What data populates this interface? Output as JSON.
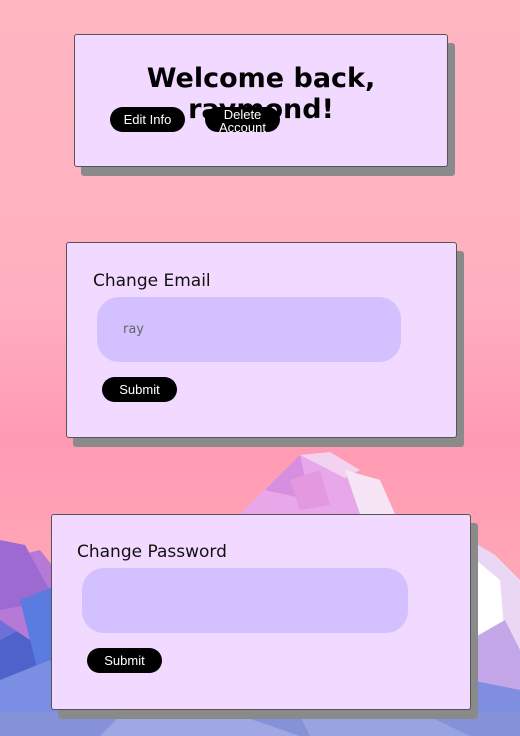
{
  "welcome": {
    "title": "Welcome back, raymond!",
    "edit_label": "Edit Info",
    "delete_label": "Delete Account"
  },
  "email": {
    "heading": "Change Email",
    "value": "ray",
    "submit_label": "Submit"
  },
  "password": {
    "heading": "Change Password",
    "value": "",
    "submit_label": "Submit"
  },
  "colors": {
    "card_bg": "#f2d9ff",
    "input_bg": "#d3c0ff",
    "button_bg": "#000000",
    "shadow": "#8a8a8a"
  }
}
